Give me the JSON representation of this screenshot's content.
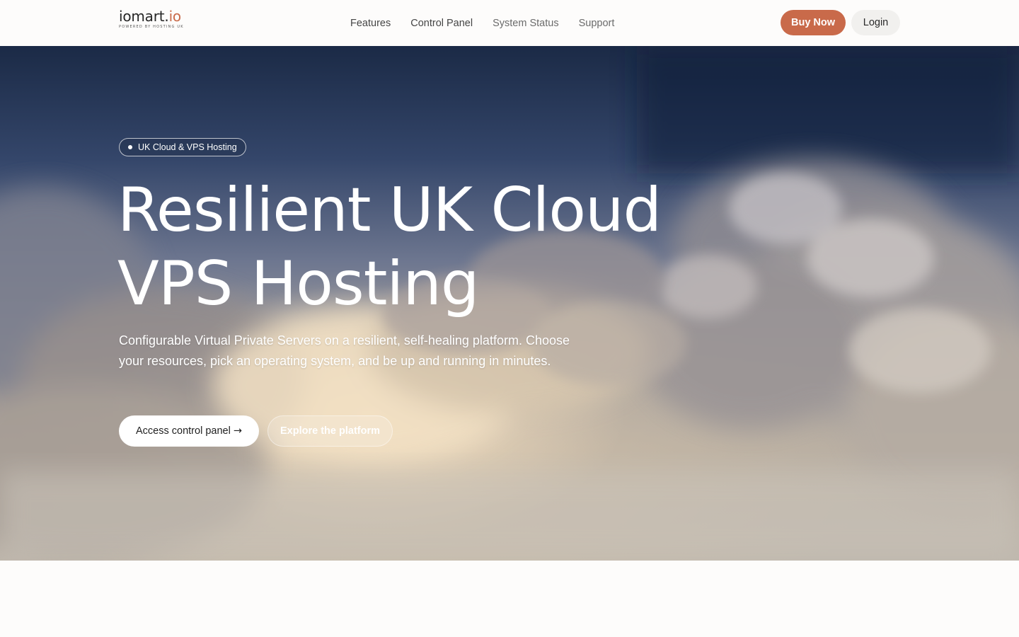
{
  "header": {
    "logo": {
      "name_prefix": "iomart.",
      "name_suffix": "io",
      "tagline": "POWERED BY HOSTING UK"
    },
    "nav": [
      {
        "label": "Features"
      },
      {
        "label": "Control Panel"
      },
      {
        "label": "System Status"
      },
      {
        "label": "Support"
      }
    ],
    "buy_label": "Buy Now",
    "login_label": "Login"
  },
  "hero": {
    "badge": "UK Cloud & VPS Hosting",
    "title_line1": "Resilient UK Cloud",
    "title_line2": "VPS Hosting",
    "description": "Configurable Virtual Private Servers on a resilient, self-healing platform. Choose your resources, pick an operating system, and be up and running in minutes.",
    "primary_cta": "Access control panel",
    "primary_cta_arrow": "→",
    "secondary_cta": "Explore the platform"
  },
  "colors": {
    "brand_accent": "#c96a4a",
    "header_bg": "#fdfcfb",
    "login_bg": "#f1f0ee"
  },
  "icons": {
    "badge_dot": "dot-icon",
    "cta_arrow": "arrow-right-icon"
  }
}
